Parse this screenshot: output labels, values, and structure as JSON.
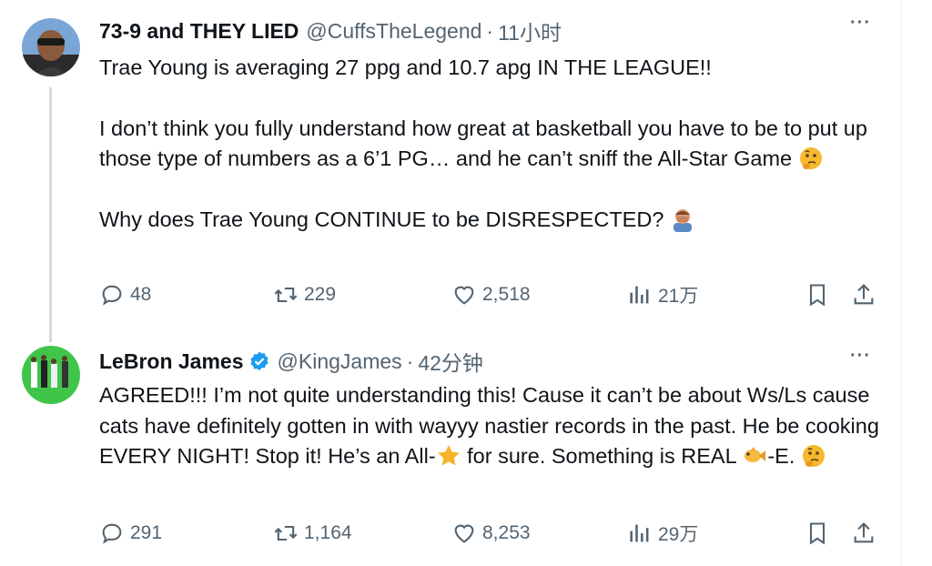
{
  "tweets": [
    {
      "author_name": "73-9 and THEY LIED",
      "handle": "@CuffsTheLegend",
      "separator": "·",
      "time": "11小时",
      "paragraphs": [
        "Trae Young is averaging 27 ppg and 10.7 apg IN THE LEAGUE!!",
        "I don’t think you fully understand how great at basketball you have to be to put up those type of numbers as a 6’1 PG… and he can’t sniff the All-Star Game",
        "Why does Trae Young CONTINUE to be DISRESPECTED?"
      ],
      "stats": {
        "replies": "48",
        "reposts": "229",
        "likes": "2,518",
        "views": "21万"
      },
      "more": "···"
    },
    {
      "author_name": "LeBron James",
      "handle": "@KingJames",
      "separator": "·",
      "time": "42分钟",
      "paragraphs": [
        "AGREED!!! I’m not quite understanding this! Cause it can’t be about Ws/Ls cause cats have definitely gotten in with wayyy nastier records in the past. He be cooking EVERY NIGHT! Stop it! He’s an All-",
        " for sure. Something is REAL ",
        "-E. "
      ],
      "stats": {
        "replies": "291",
        "reposts": "1,164",
        "likes": "8,253",
        "views": "29万"
      },
      "more": "···"
    }
  ],
  "icons": {
    "reply": "reply-icon",
    "repost": "repost-icon",
    "like": "heart-icon",
    "views": "views-chart-icon",
    "bookmark": "bookmark-icon",
    "share": "share-icon",
    "verified": "verified-badge-icon",
    "emoji_thinking": "thinking-face-emoji",
    "emoji_facepalm": "man-facepalming-emoji",
    "emoji_star": "star-emoji",
    "emoji_fish": "fish-emoji"
  },
  "colors": {
    "text": "#0f1419",
    "muted": "#536471",
    "verified": "#1d9bf0",
    "thread_line": "#cfd9de"
  }
}
